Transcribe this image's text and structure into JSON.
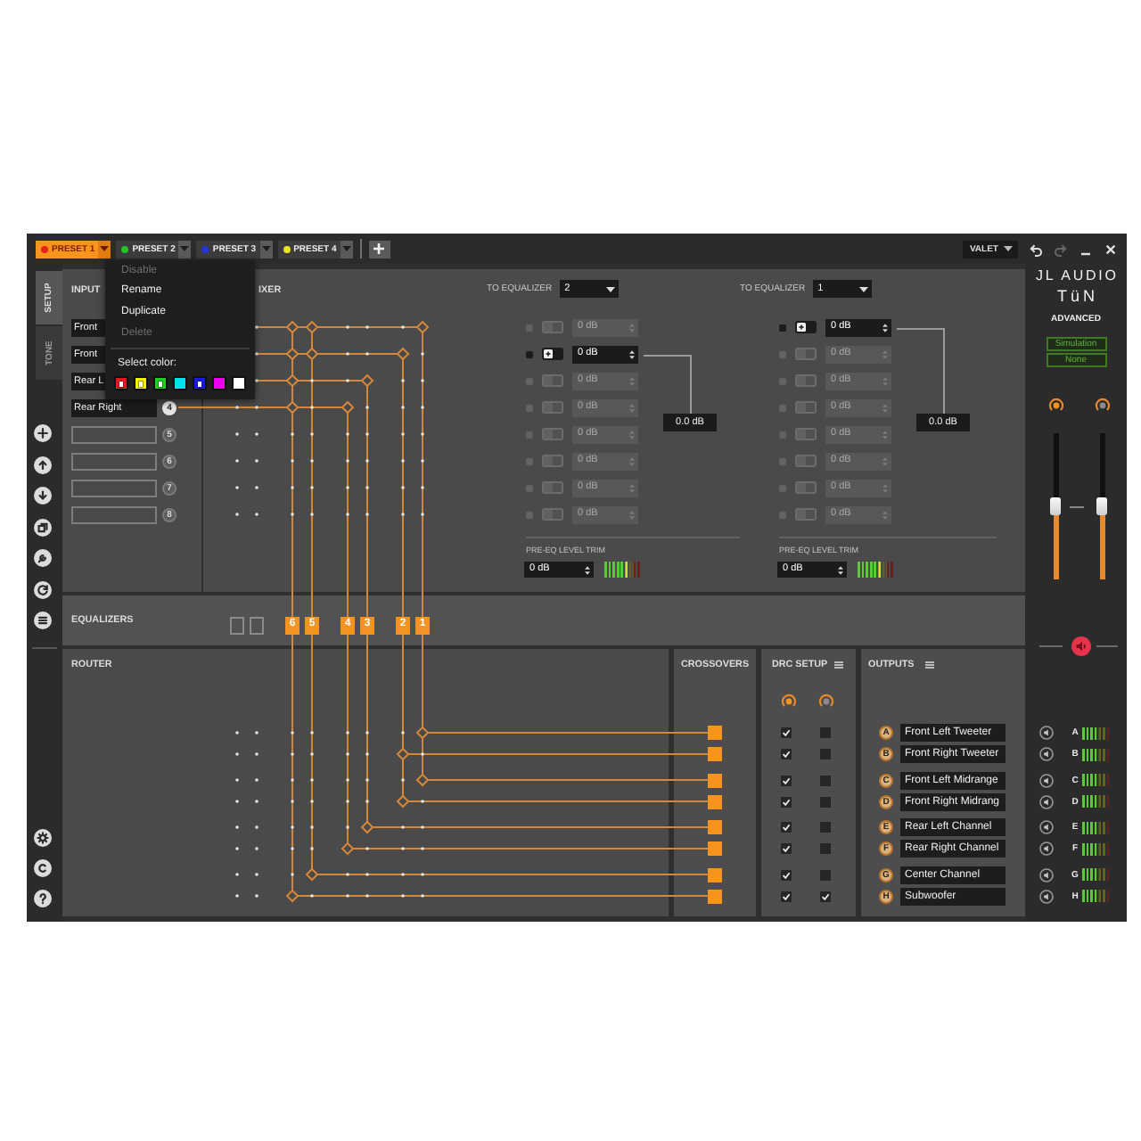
{
  "presets": [
    {
      "label": "PRESET 1",
      "color": "#e8231c",
      "selected": true
    },
    {
      "label": "PRESET 2",
      "color": "#25c425",
      "selected": false
    },
    {
      "label": "PRESET 3",
      "color": "#2634e0",
      "selected": false
    },
    {
      "label": "PRESET 4",
      "color": "#efe51f",
      "selected": false
    }
  ],
  "valet": {
    "label": "VALET"
  },
  "toolbar": {
    "undo": {
      "disabled": false
    },
    "redo": {
      "disabled": true
    }
  },
  "preset_menu": {
    "items": [
      {
        "label": "Disable",
        "disabled": true
      },
      {
        "label": "Rename",
        "disabled": false
      },
      {
        "label": "Duplicate",
        "disabled": false
      },
      {
        "label": "Delete",
        "disabled": true
      }
    ],
    "color_label": "Select color:",
    "colors": [
      {
        "color": "#e8141e",
        "marked": true
      },
      {
        "color": "#f2f000",
        "marked": true
      },
      {
        "color": "#20d020",
        "marked": true
      },
      {
        "color": "#00e1ea",
        "marked": false
      },
      {
        "color": "#1818e6",
        "marked": true
      },
      {
        "color": "#ef00ef",
        "marked": false
      },
      {
        "color": "#ffffff",
        "marked": false
      }
    ]
  },
  "side_tabs": [
    {
      "label": "SETUP",
      "selected": true
    },
    {
      "label": "TONE",
      "selected": false
    }
  ],
  "inputs": {
    "title": "INPUT",
    "channels": [
      {
        "name": "Front"
      },
      {
        "name": "Front"
      },
      {
        "name": "Rear L"
      },
      {
        "name": "Rear Right",
        "number": "4"
      },
      {
        "number": "5"
      },
      {
        "number": "6"
      },
      {
        "number": "7"
      },
      {
        "number": "8"
      }
    ]
  },
  "mixer": {
    "title": "IXER",
    "rows": [
      {
        "routes": [
          false,
          true,
          true,
          false,
          false,
          false,
          true
        ]
      },
      {
        "routes": [
          false,
          true,
          true,
          false,
          false,
          true,
          false
        ]
      },
      {
        "routes": [
          false,
          true,
          false,
          false,
          true,
          false,
          false
        ]
      },
      {
        "routes": [
          false,
          false,
          true,
          false,
          true,
          false,
          false,
          false
        ]
      },
      {
        "routes": [
          false,
          false,
          false,
          false,
          false,
          false,
          false,
          false
        ]
      },
      {
        "routes": [
          false,
          false,
          false,
          false,
          false,
          false,
          false,
          false
        ]
      },
      {
        "routes": [
          false,
          false,
          false,
          false,
          false,
          false,
          false,
          false
        ]
      },
      {
        "routes": [
          false,
          false,
          false,
          false,
          false,
          false,
          false,
          false
        ]
      }
    ]
  },
  "eq_feeds": [
    {
      "label": "TO EQUALIZER",
      "value": "2",
      "rows": [
        {
          "gain": "0 dB",
          "selected": false
        },
        {
          "gain": "0 dB",
          "selected": true
        },
        {
          "gain": "0 dB",
          "selected": false
        },
        {
          "gain": "0 dB",
          "selected": false
        },
        {
          "gain": "0 dB",
          "selected": false
        },
        {
          "gain": "0 dB",
          "selected": false
        },
        {
          "gain": "0 dB",
          "selected": false
        },
        {
          "gain": "0 dB",
          "selected": false
        }
      ],
      "output": "0.0 dB",
      "trim_label": "PRE-EQ LEVEL TRIM",
      "trim": "0 dB",
      "trim_meter": {
        "level": 0.7
      }
    },
    {
      "label": "TO EQUALIZER",
      "value": "1",
      "rows": [
        {
          "gain": "0 dB",
          "selected": true
        },
        {
          "gain": "0 dB",
          "selected": false
        },
        {
          "gain": "0 dB",
          "selected": false
        },
        {
          "gain": "0 dB",
          "selected": false
        },
        {
          "gain": "0 dB",
          "selected": false
        },
        {
          "gain": "0 dB",
          "selected": false
        },
        {
          "gain": "0 dB",
          "selected": false
        },
        {
          "gain": "0 dB",
          "selected": false
        }
      ],
      "output": "0.0 dB",
      "trim_label": "PRE-EQ LEVEL TRIM",
      "trim": "0 dB",
      "trim_meter": {
        "level": 0.7
      }
    }
  ],
  "equalizers": {
    "title": "EQUALIZERS",
    "channels": [
      {
        "active": false
      },
      {
        "active": false
      },
      {
        "label": "6",
        "active": true
      },
      {
        "label": "5",
        "active": true
      },
      {
        "label": "4",
        "active": true
      },
      {
        "label": "3",
        "active": true
      },
      {
        "label": "2",
        "active": true
      },
      {
        "label": "1",
        "active": true
      }
    ]
  },
  "router": {
    "title": "ROUTER",
    "rows": [
      {
        "routes": [
          false,
          false,
          false,
          false,
          false,
          false,
          false,
          true
        ]
      },
      {
        "routes": [
          false,
          false,
          false,
          false,
          false,
          false,
          true,
          false
        ]
      },
      {
        "routes": [
          false,
          false,
          false,
          false,
          false,
          false,
          false,
          true
        ]
      },
      {
        "routes": [
          false,
          false,
          false,
          false,
          false,
          false,
          true,
          false
        ]
      },
      {
        "routes": [
          false,
          false,
          false,
          false,
          false,
          true,
          false,
          false
        ]
      },
      {
        "routes": [
          false,
          false,
          false,
          false,
          true,
          false,
          false,
          false
        ]
      },
      {
        "routes": [
          false,
          false,
          false,
          true,
          false,
          false,
          false,
          false
        ]
      },
      {
        "routes": [
          false,
          false,
          true,
          false,
          false,
          false,
          false,
          false
        ]
      }
    ]
  },
  "crossovers": {
    "title": "CROSSOVERS",
    "channels": [
      {
        "active": true
      },
      {
        "active": true
      },
      {
        "active": true
      },
      {
        "active": true
      },
      {
        "active": true
      },
      {
        "active": true
      },
      {
        "active": true
      },
      {
        "active": true
      }
    ]
  },
  "drc": {
    "title": "DRC SETUP",
    "modes": [
      {
        "selected": true
      },
      {
        "selected": false
      }
    ],
    "rows": [
      {
        "checked": [
          true,
          false
        ]
      },
      {
        "checked": [
          true,
          false
        ]
      },
      {
        "checked": [
          true,
          false
        ]
      },
      {
        "checked": [
          true,
          false
        ]
      },
      {
        "checked": [
          true,
          false
        ]
      },
      {
        "checked": [
          true,
          false
        ]
      },
      {
        "checked": [
          true,
          false
        ]
      },
      {
        "checked": [
          true,
          true
        ]
      }
    ]
  },
  "outputs": {
    "title": "OUTPUTS",
    "channels": [
      {
        "letter": "A",
        "name": "Front Left Tweeter"
      },
      {
        "letter": "B",
        "name": "Front Right Tweeter"
      },
      {
        "letter": "C",
        "name": "Front Left Midrange"
      },
      {
        "letter": "D",
        "name": "Front Right Midrang"
      },
      {
        "letter": "E",
        "name": "Rear Left Channel"
      },
      {
        "letter": "F",
        "name": "Rear Right Channel"
      },
      {
        "letter": "G",
        "name": "Center Channel"
      },
      {
        "letter": "H",
        "name": "Subwoofer"
      }
    ]
  },
  "side_panel": {
    "brand": "JL AUDIO",
    "product": "TüN",
    "edition": "ADVANCED",
    "badges": [
      "Simulation",
      "None"
    ],
    "knobs": [
      {
        "selected": true
      },
      {
        "selected": false
      }
    ],
    "faders": [
      {
        "level": 0.5
      },
      {
        "level": 0.5
      }
    ],
    "mute": {
      "muted": true
    },
    "meters": [
      {
        "letter": "A",
        "level": 0.5
      },
      {
        "letter": "B",
        "level": 0.5
      },
      {
        "letter": "C",
        "level": 0.5
      },
      {
        "letter": "D",
        "level": 0.5
      },
      {
        "letter": "E",
        "level": 0.5
      },
      {
        "letter": "F",
        "level": 0.5
      },
      {
        "letter": "G",
        "level": 0.5
      },
      {
        "letter": "H",
        "level": 0.5
      }
    ]
  }
}
